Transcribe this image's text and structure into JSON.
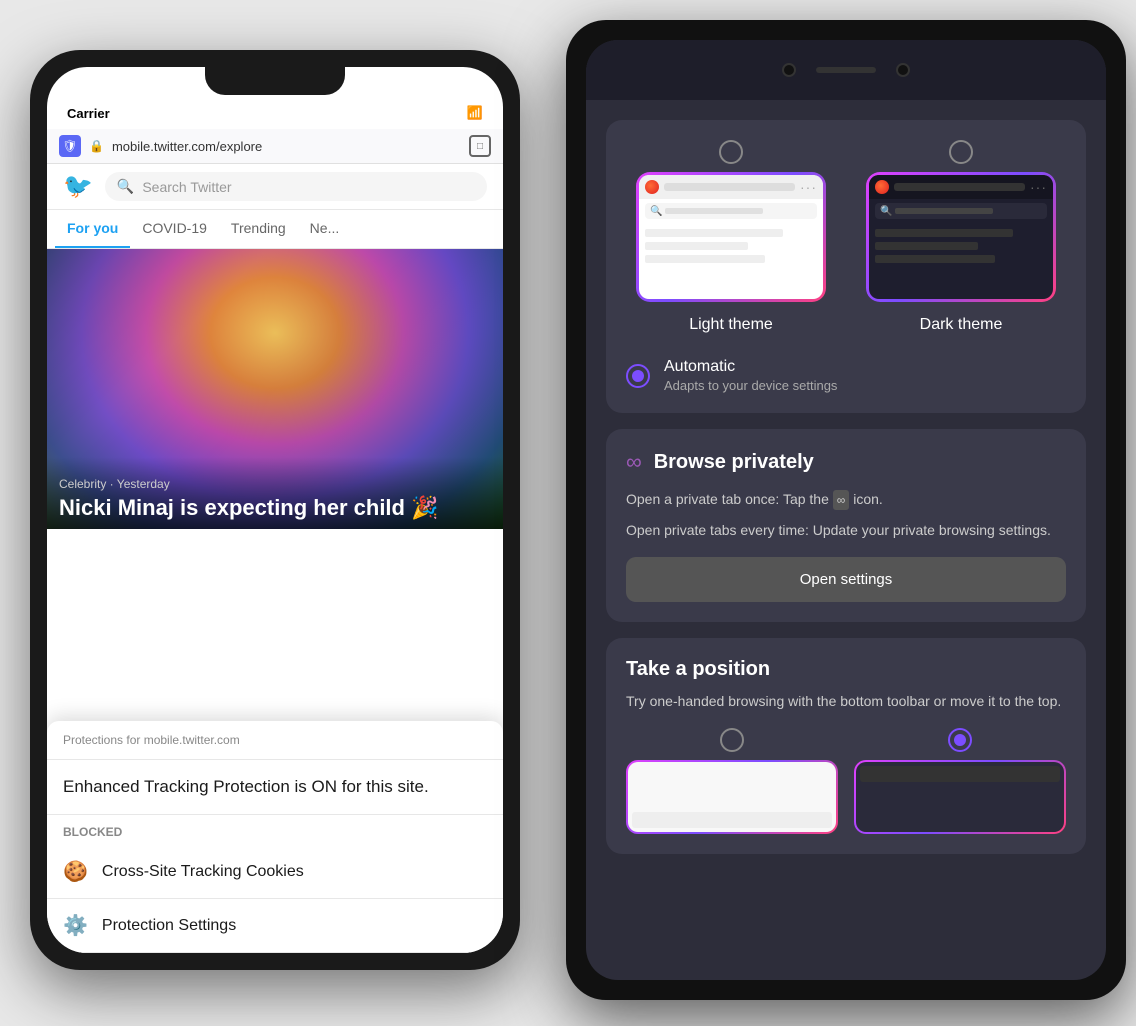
{
  "page": {
    "background_color": "#e8e8e8"
  },
  "phone_left": {
    "status": {
      "carrier": "Carrier",
      "wifi": "📶"
    },
    "browser": {
      "url": "mobile.twitter.com/explore",
      "shield_icon": "🛡",
      "lock_icon": "🔒"
    },
    "twitter": {
      "search_placeholder": "Search Twitter",
      "tabs": [
        "For you",
        "COVID-19",
        "Trending",
        "Ne..."
      ],
      "active_tab": "For you"
    },
    "hero": {
      "category": "Celebrity · Yesterday",
      "title": "Nicki Minaj is expecting her child 🎉"
    },
    "popup": {
      "header": "Protections for mobile.twitter.com",
      "main_text": "Enhanced Tracking Protection is ON for this site.",
      "blocked_label": "Blocked",
      "items": [
        {
          "icon": "🍪",
          "text": "Cross-Site Tracking Cookies"
        },
        {
          "icon": "⚙️",
          "text": "Protection Settings"
        }
      ]
    }
  },
  "phone_right": {
    "theme_section": {
      "light_theme_label": "Light theme",
      "dark_theme_label": "Dark theme",
      "automatic_label": "Automatic",
      "automatic_subtitle": "Adapts to your device settings"
    },
    "browse_privately": {
      "title": "Browse privately",
      "body1": "Open a private tab once: Tap the",
      "body1_icon": "∞",
      "body1_end": "icon.",
      "body2": "Open private tabs every time: Update your private browsing settings.",
      "button_label": "Open settings"
    },
    "take_position": {
      "title": "Take a position",
      "body": "Try one-handed browsing with the bottom toolbar or move it to the top."
    }
  }
}
